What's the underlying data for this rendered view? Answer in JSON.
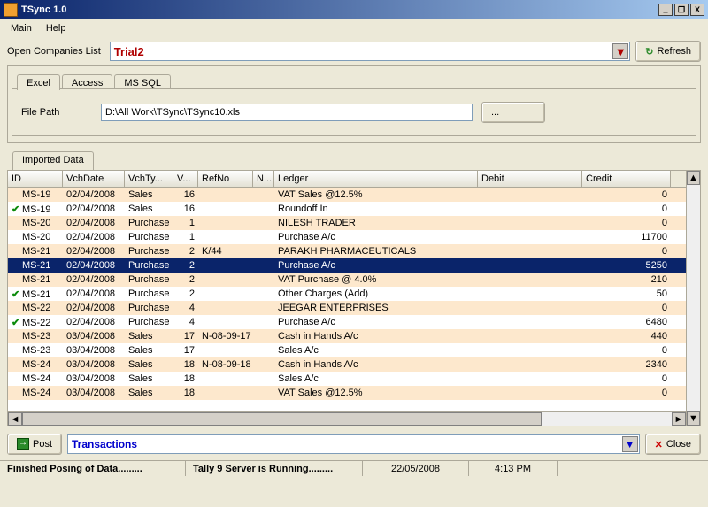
{
  "title": "TSync 1.0",
  "menu": {
    "main": "Main",
    "help": "Help"
  },
  "toprow": {
    "label": "Open Companies List",
    "value": "Trial2",
    "refresh": "Refresh"
  },
  "tabs": {
    "excel": "Excel",
    "access": "Access",
    "mssql": "MS SQL"
  },
  "filepath": {
    "label": "File Path",
    "value": "D:\\All Work\\TSync\\TSync10.xls",
    "browse": "..."
  },
  "imported_tab": "Imported Data",
  "columns": [
    "ID",
    "VchDate",
    "VchTy...",
    "V...",
    "RefNo",
    "N...",
    "Ledger",
    "Debit",
    "Credit"
  ],
  "rows": [
    {
      "chk": false,
      "id": "MS-19",
      "date": "02/04/2008",
      "type": "Sales",
      "v": "16",
      "ref": "",
      "n": "",
      "ledger": "VAT Sales @12.5%",
      "debit": "",
      "credit": "0"
    },
    {
      "chk": true,
      "id": "MS-19",
      "date": "02/04/2008",
      "type": "Sales",
      "v": "16",
      "ref": "",
      "n": "",
      "ledger": "Roundoff In",
      "debit": "",
      "credit": "0"
    },
    {
      "chk": false,
      "id": "MS-20",
      "date": "02/04/2008",
      "type": "Purchase",
      "v": "1",
      "ref": "",
      "n": "",
      "ledger": "NILESH TRADER",
      "debit": "",
      "credit": "0"
    },
    {
      "chk": false,
      "id": "MS-20",
      "date": "02/04/2008",
      "type": "Purchase",
      "v": "1",
      "ref": "",
      "n": "",
      "ledger": "Purchase A/c",
      "debit": "",
      "credit": "11700"
    },
    {
      "chk": false,
      "id": "MS-21",
      "date": "02/04/2008",
      "type": "Purchase",
      "v": "2",
      "ref": "K/44",
      "n": "",
      "ledger": "PARAKH PHARMACEUTICALS",
      "debit": "",
      "credit": "0"
    },
    {
      "chk": false,
      "sel": true,
      "id": "MS-21",
      "date": "02/04/2008",
      "type": "Purchase",
      "v": "2",
      "ref": "",
      "n": "",
      "ledger": "Purchase A/c",
      "debit": "",
      "credit": "5250"
    },
    {
      "chk": false,
      "id": "MS-21",
      "date": "02/04/2008",
      "type": "Purchase",
      "v": "2",
      "ref": "",
      "n": "",
      "ledger": "VAT Purchase @ 4.0%",
      "debit": "",
      "credit": "210"
    },
    {
      "chk": true,
      "id": "MS-21",
      "date": "02/04/2008",
      "type": "Purchase",
      "v": "2",
      "ref": "",
      "n": "",
      "ledger": "Other Charges (Add)",
      "debit": "",
      "credit": "50"
    },
    {
      "chk": false,
      "id": "MS-22",
      "date": "02/04/2008",
      "type": "Purchase",
      "v": "4",
      "ref": "",
      "n": "",
      "ledger": "JEEGAR ENTERPRISES",
      "debit": "",
      "credit": "0"
    },
    {
      "chk": true,
      "id": "MS-22",
      "date": "02/04/2008",
      "type": "Purchase",
      "v": "4",
      "ref": "",
      "n": "",
      "ledger": "Purchase A/c",
      "debit": "",
      "credit": "6480"
    },
    {
      "chk": false,
      "id": "MS-23",
      "date": "03/04/2008",
      "type": "Sales",
      "v": "17",
      "ref": "N-08-09-17",
      "n": "",
      "ledger": "Cash in Hands A/c",
      "debit": "",
      "credit": "440"
    },
    {
      "chk": false,
      "id": "MS-23",
      "date": "03/04/2008",
      "type": "Sales",
      "v": "17",
      "ref": "",
      "n": "",
      "ledger": "Sales A/c",
      "debit": "",
      "credit": "0"
    },
    {
      "chk": false,
      "id": "MS-24",
      "date": "03/04/2008",
      "type": "Sales",
      "v": "18",
      "ref": "N-08-09-18",
      "n": "",
      "ledger": "Cash in Hands A/c",
      "debit": "",
      "credit": "2340"
    },
    {
      "chk": false,
      "id": "MS-24",
      "date": "03/04/2008",
      "type": "Sales",
      "v": "18",
      "ref": "",
      "n": "",
      "ledger": "Sales A/c",
      "debit": "",
      "credit": "0"
    },
    {
      "chk": false,
      "id": "MS-24",
      "date": "03/04/2008",
      "type": "Sales",
      "v": "18",
      "ref": "",
      "n": "",
      "ledger": "VAT Sales @12.5%",
      "debit": "",
      "credit": "0"
    }
  ],
  "bottom": {
    "post": "Post",
    "trans": "Transactions",
    "close": "Close"
  },
  "status": {
    "msg1": "Finished Posing of Data.........",
    "msg2": "Tally 9 Server is Running.........",
    "date": "22/05/2008",
    "time": "4:13 PM"
  }
}
